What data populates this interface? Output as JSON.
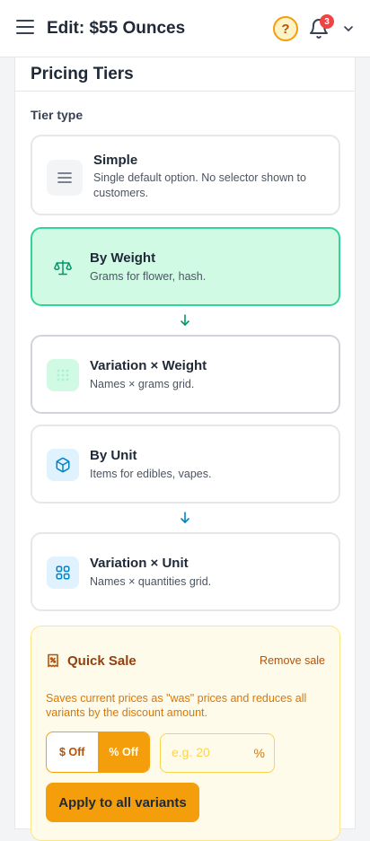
{
  "header": {
    "title": "Edit: $55 Ounces",
    "help_glyph": "?",
    "notification_count": "3",
    "icons": [
      "menu-icon",
      "help-icon",
      "bell-icon",
      "chevron-down-icon"
    ]
  },
  "section": {
    "title": "Pricing Tiers",
    "tier_type_label": "Tier type"
  },
  "tiers": [
    {
      "key": "simple",
      "title": "Simple",
      "desc": "Single default option. No selector shown to customers.",
      "icon": "list-icon",
      "selected": false
    },
    {
      "key": "weight",
      "title": "By Weight",
      "desc": "Grams for flower, hash.",
      "icon": "scale-icon",
      "selected": true
    },
    {
      "key": "variation_weight",
      "title": "Variation × Weight",
      "desc": "Names × grams grid.",
      "icon": "grid-dots-icon",
      "selected": false
    },
    {
      "key": "unit",
      "title": "By Unit",
      "desc": "Items for edibles, vapes.",
      "icon": "box-icon",
      "selected": false
    },
    {
      "key": "variation_unit",
      "title": "Variation × Unit",
      "desc": "Names × quantities grid.",
      "icon": "grid-squares-icon",
      "selected": false
    }
  ],
  "quick_sale": {
    "title": "Quick Sale",
    "remove_label": "Remove sale",
    "description": "Saves current prices as \"was\" prices and reduces all variants by the discount amount.",
    "toggle": {
      "dollar_label": "$ Off",
      "percent_label": "% Off",
      "selected": "percent"
    },
    "amount_placeholder": "e.g. 20",
    "amount_value": "",
    "unit": "%",
    "apply_label": "Apply to all variants"
  },
  "colors": {
    "accent": "#f59e0b",
    "selected_bg": "#d1fae5",
    "selected_border": "#34d399",
    "badge": "#ef4444"
  }
}
